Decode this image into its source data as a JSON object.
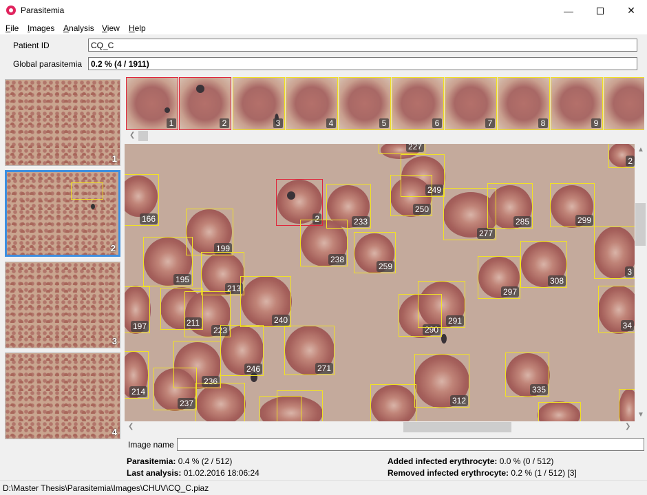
{
  "window": {
    "title": "Parasitemia"
  },
  "menu": [
    {
      "mnemonic": "F",
      "rest": "ile"
    },
    {
      "mnemonic": "I",
      "rest": "mages"
    },
    {
      "mnemonic": "A",
      "rest": "nalysis"
    },
    {
      "mnemonic": "V",
      "rest": "iew"
    },
    {
      "mnemonic": "H",
      "rest": "elp"
    }
  ],
  "patient": {
    "id_label": "Patient ID",
    "id_value": "CQ_C",
    "global_label": "Global parasitemia",
    "global_value": "0.2 % (4 / 1911)"
  },
  "thumbnails": [
    "1",
    "2",
    "3",
    "4"
  ],
  "selected_thumbnail": "2",
  "strip_tiles": [
    "1",
    "2",
    "3",
    "4",
    "5",
    "6",
    "7",
    "8",
    "9"
  ],
  "viewer_labels": [
    "227",
    "249",
    "250",
    "277",
    "285",
    "299",
    "166",
    "2",
    "233",
    "199",
    "238",
    "259",
    "195",
    "213",
    "308",
    "297",
    "240",
    "211",
    "223",
    "290",
    "291",
    "197",
    "246",
    "271",
    "214",
    "236",
    "237",
    "312",
    "335",
    "3",
    "34",
    "2"
  ],
  "image_name": {
    "label": "Image name",
    "value": ""
  },
  "stats": {
    "parasitemia_label": "Parasitemia:",
    "parasitemia_value": "0.4 % (2 / 512)",
    "last_analysis_label": "Last analysis:",
    "last_analysis_value": "01.02.2016 18:06:24",
    "added_label": "Added infected erythrocyte:",
    "added_value": "0.0 % (0 / 512)",
    "removed_label": "Removed infected erythrocyte:",
    "removed_value": "0.2 % (1 / 512) [3]"
  },
  "status_bar": "D:\\Master Thesis\\Parasitemia\\Images\\CHUV\\CQ_C.piaz",
  "colors": {
    "selection": "#3d8fe0",
    "healthy_box": "#f1e125",
    "infected_box": "#e0263b"
  }
}
